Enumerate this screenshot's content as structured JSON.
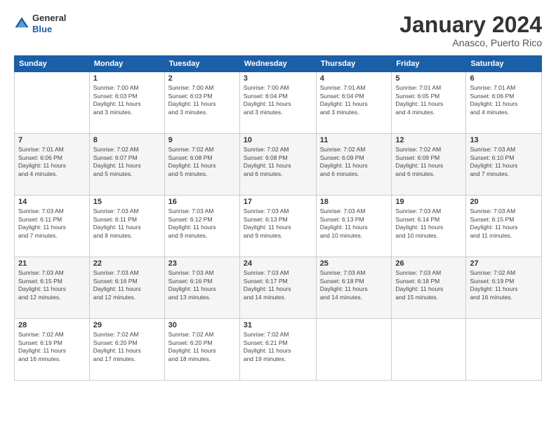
{
  "header": {
    "logo": {
      "general": "General",
      "blue": "Blue"
    },
    "title": "January 2024",
    "location": "Anasco, Puerto Rico"
  },
  "days_of_week": [
    "Sunday",
    "Monday",
    "Tuesday",
    "Wednesday",
    "Thursday",
    "Friday",
    "Saturday"
  ],
  "weeks": [
    [
      {
        "num": "",
        "info": ""
      },
      {
        "num": "1",
        "info": "Sunrise: 7:00 AM\nSunset: 6:03 PM\nDaylight: 11 hours\nand 3 minutes."
      },
      {
        "num": "2",
        "info": "Sunrise: 7:00 AM\nSunset: 6:03 PM\nDaylight: 11 hours\nand 3 minutes."
      },
      {
        "num": "3",
        "info": "Sunrise: 7:00 AM\nSunset: 6:04 PM\nDaylight: 11 hours\nand 3 minutes."
      },
      {
        "num": "4",
        "info": "Sunrise: 7:01 AM\nSunset: 6:04 PM\nDaylight: 11 hours\nand 3 minutes."
      },
      {
        "num": "5",
        "info": "Sunrise: 7:01 AM\nSunset: 6:05 PM\nDaylight: 11 hours\nand 4 minutes."
      },
      {
        "num": "6",
        "info": "Sunrise: 7:01 AM\nSunset: 6:06 PM\nDaylight: 11 hours\nand 4 minutes."
      }
    ],
    [
      {
        "num": "7",
        "info": "Sunrise: 7:01 AM\nSunset: 6:06 PM\nDaylight: 11 hours\nand 4 minutes."
      },
      {
        "num": "8",
        "info": "Sunrise: 7:02 AM\nSunset: 6:07 PM\nDaylight: 11 hours\nand 5 minutes."
      },
      {
        "num": "9",
        "info": "Sunrise: 7:02 AM\nSunset: 6:08 PM\nDaylight: 11 hours\nand 5 minutes."
      },
      {
        "num": "10",
        "info": "Sunrise: 7:02 AM\nSunset: 6:08 PM\nDaylight: 11 hours\nand 6 minutes."
      },
      {
        "num": "11",
        "info": "Sunrise: 7:02 AM\nSunset: 6:09 PM\nDaylight: 11 hours\nand 6 minutes."
      },
      {
        "num": "12",
        "info": "Sunrise: 7:02 AM\nSunset: 6:09 PM\nDaylight: 11 hours\nand 6 minutes."
      },
      {
        "num": "13",
        "info": "Sunrise: 7:03 AM\nSunset: 6:10 PM\nDaylight: 11 hours\nand 7 minutes."
      }
    ],
    [
      {
        "num": "14",
        "info": "Sunrise: 7:03 AM\nSunset: 6:11 PM\nDaylight: 11 hours\nand 7 minutes."
      },
      {
        "num": "15",
        "info": "Sunrise: 7:03 AM\nSunset: 6:11 PM\nDaylight: 11 hours\nand 8 minutes."
      },
      {
        "num": "16",
        "info": "Sunrise: 7:03 AM\nSunset: 6:12 PM\nDaylight: 11 hours\nand 9 minutes."
      },
      {
        "num": "17",
        "info": "Sunrise: 7:03 AM\nSunset: 6:13 PM\nDaylight: 11 hours\nand 9 minutes."
      },
      {
        "num": "18",
        "info": "Sunrise: 7:03 AM\nSunset: 6:13 PM\nDaylight: 11 hours\nand 10 minutes."
      },
      {
        "num": "19",
        "info": "Sunrise: 7:03 AM\nSunset: 6:14 PM\nDaylight: 11 hours\nand 10 minutes."
      },
      {
        "num": "20",
        "info": "Sunrise: 7:03 AM\nSunset: 6:15 PM\nDaylight: 11 hours\nand 11 minutes."
      }
    ],
    [
      {
        "num": "21",
        "info": "Sunrise: 7:03 AM\nSunset: 6:15 PM\nDaylight: 11 hours\nand 12 minutes."
      },
      {
        "num": "22",
        "info": "Sunrise: 7:03 AM\nSunset: 6:16 PM\nDaylight: 11 hours\nand 12 minutes."
      },
      {
        "num": "23",
        "info": "Sunrise: 7:03 AM\nSunset: 6:16 PM\nDaylight: 11 hours\nand 13 minutes."
      },
      {
        "num": "24",
        "info": "Sunrise: 7:03 AM\nSunset: 6:17 PM\nDaylight: 11 hours\nand 14 minutes."
      },
      {
        "num": "25",
        "info": "Sunrise: 7:03 AM\nSunset: 6:18 PM\nDaylight: 11 hours\nand 14 minutes."
      },
      {
        "num": "26",
        "info": "Sunrise: 7:03 AM\nSunset: 6:18 PM\nDaylight: 11 hours\nand 15 minutes."
      },
      {
        "num": "27",
        "info": "Sunrise: 7:02 AM\nSunset: 6:19 PM\nDaylight: 11 hours\nand 16 minutes."
      }
    ],
    [
      {
        "num": "28",
        "info": "Sunrise: 7:02 AM\nSunset: 6:19 PM\nDaylight: 11 hours\nand 16 minutes."
      },
      {
        "num": "29",
        "info": "Sunrise: 7:02 AM\nSunset: 6:20 PM\nDaylight: 11 hours\nand 17 minutes."
      },
      {
        "num": "30",
        "info": "Sunrise: 7:02 AM\nSunset: 6:20 PM\nDaylight: 11 hours\nand 18 minutes."
      },
      {
        "num": "31",
        "info": "Sunrise: 7:02 AM\nSunset: 6:21 PM\nDaylight: 11 hours\nand 19 minutes."
      },
      {
        "num": "",
        "info": ""
      },
      {
        "num": "",
        "info": ""
      },
      {
        "num": "",
        "info": ""
      }
    ]
  ]
}
